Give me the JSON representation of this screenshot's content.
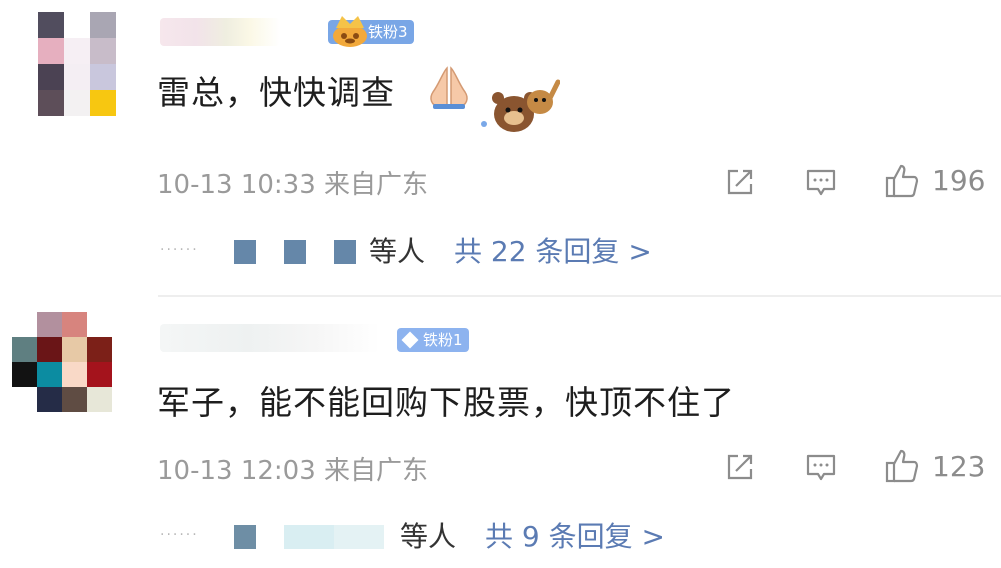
{
  "comments": [
    {
      "badge": "铁粉3",
      "text": "雷总，快快调查",
      "time": "10-13 10:33",
      "location": "来自广东",
      "likes": "196",
      "reply_who": "等人",
      "reply_total": "共 22 条回复 >",
      "avatar_colors": [
        "#ffffff",
        "#514d5e",
        "#ffffff",
        "#a9a6b3",
        "#ffffff",
        "#e6afbf",
        "#f6eff4",
        "#c8bcc9",
        "#ffffff",
        "#4b4253",
        "#f4eef3",
        "#c9c7dd",
        "#ffffff",
        "#5d4e59",
        "#f3f1f2",
        "#f7c711"
      ],
      "reply_squares": [
        "#6587a9",
        "#6587a9",
        "#6587a9"
      ]
    },
    {
      "badge": "铁粉1",
      "text": "军子，能不能回购下股票，快顶不住了",
      "time": "10-13 12:03",
      "location": "来自广东",
      "likes": "123",
      "reply_who": "等人",
      "reply_total": "共 9 条回复 >",
      "avatar_colors": [
        "#ffffff",
        "#b2909e",
        "#d7847e",
        "#ffffff",
        "#5f7f81",
        "#6a1517",
        "#e7c9a6",
        "#7c2018",
        "#121212",
        "#0c8ca1",
        "#f9d9c7",
        "#a4131c",
        "#ffffff",
        "#252c47",
        "#5f4c43",
        "#e7e7d8"
      ],
      "reply_squares": [
        "#6e8ea5",
        "#d9eef2",
        "#e4f2f4"
      ]
    }
  ]
}
